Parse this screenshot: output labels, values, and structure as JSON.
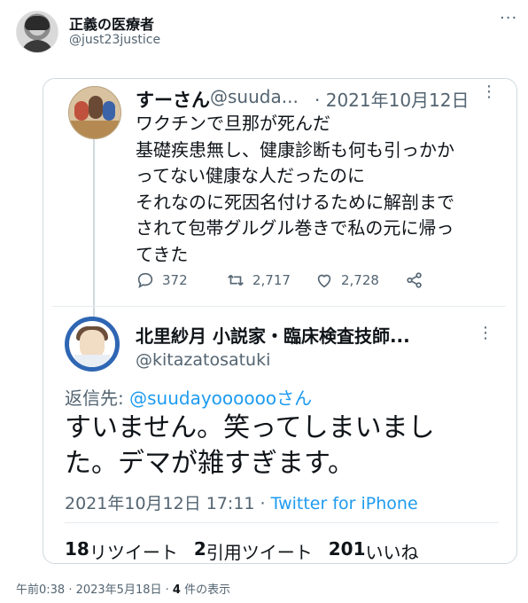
{
  "author": {
    "display_name": "正義の医療者",
    "handle": "@just23justice"
  },
  "embedded": {
    "tweet1": {
      "name": "すーさん",
      "handle": "@suuda...",
      "date": "· 2021年10月12日",
      "body": "ワクチンで旦那が死んだ\n基礎疾患無し、健康診断も何も引っかか\nってない健康な人だったのに\nそれなのに死因名付けるために解剖まで\nされて包帯グルグル巻きで私の元に帰っ\nてきた",
      "replies": "372",
      "retweets": "2,717",
      "likes": "2,728"
    },
    "tweet2": {
      "name": "北里紗月 小説家・臨床検査技師...",
      "handle": "@kitazatosatuki",
      "reply_label": "返信先: ",
      "reply_mention": "@suudayoooooo",
      "reply_suffix": "さん",
      "body": "すいません。笑ってしまいまし\nた。デマが雑すぎます。",
      "time": "2021年10月12日 17:11 · ",
      "source": "Twitter for iPhone",
      "retweets_count": "18",
      "retweets_label": " リツイート",
      "quotes_count": "2",
      "quotes_label": " 引用ツイート",
      "likes_count": "201",
      "likes_label": " いいね"
    }
  },
  "footer": {
    "timestamp": "午前0:38 · 2023年5月18日 · ",
    "views_count": "4",
    "views_label": " 件の表示"
  },
  "colors": {
    "link": "#1d9bf0",
    "muted": "#536471",
    "text": "#0f1419",
    "border": "#cfd9de"
  },
  "icons": [
    "more-icon",
    "reply-icon",
    "retweet-icon",
    "like-icon",
    "share-icon"
  ]
}
